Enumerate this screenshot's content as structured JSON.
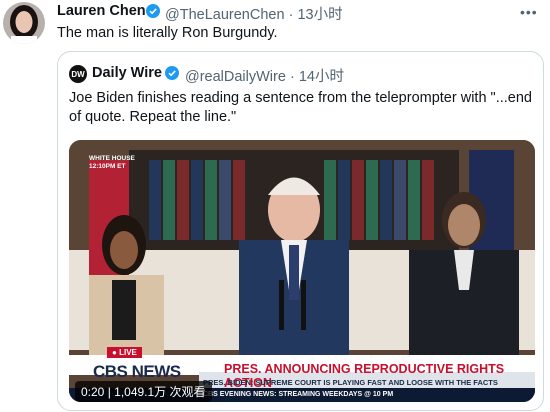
{
  "tweet": {
    "author_name": "Lauren Chen",
    "handle": "@TheLaurenChen",
    "time": "13小时",
    "text": "The man is literally Ron Burgundy.",
    "more_icon": "more-dots-icon"
  },
  "quote": {
    "logo_text": "DW",
    "author_name": "Daily Wire",
    "handle": "@realDailyWire",
    "time": "14小时",
    "text": "Joe Biden finishes reading a sentence from the teleprompter with \"...end of quote. Repeat the line.\""
  },
  "video": {
    "corner_tag_line1": "WHITE HOUSE",
    "corner_tag_line2": "12:10PM ET",
    "live_label": "LIVE",
    "network": "CBS NEWS",
    "headline": "PRES. ANNOUNCING REPRODUCTIVE RIGHTS ACTION",
    "subline": "PRES. BIDEN: SUPREME COURT IS PLAYING FAST AND LOOSE WITH THE FACTS",
    "ticker": "CBS EVENING NEWS: STREAMING WEEKDAYS @ 10 PM",
    "timestamp_views": "0:20 | 1,049.1万 次观看"
  },
  "colors": {
    "verified_blue": "#1d9bf0",
    "cbs_red": "#c8102e",
    "cbs_navy": "#1a2a4a"
  }
}
